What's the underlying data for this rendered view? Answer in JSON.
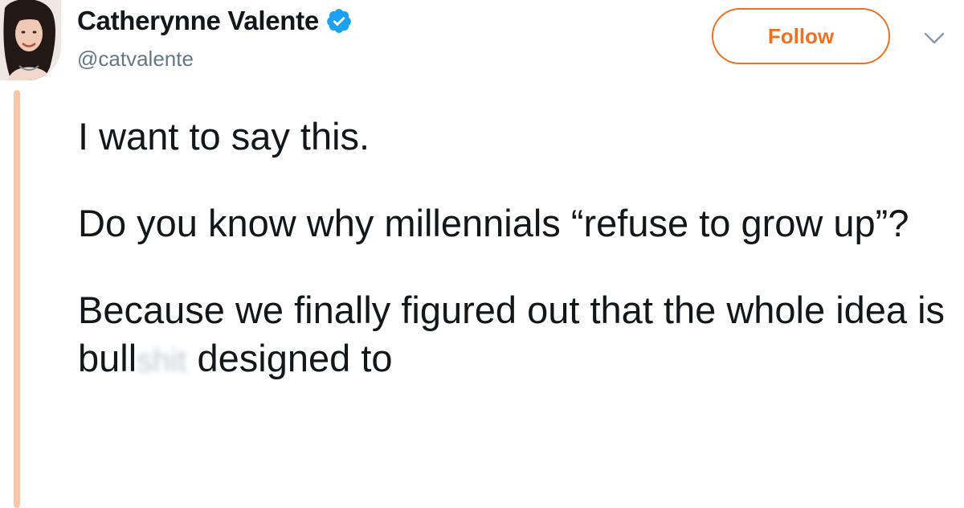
{
  "author": {
    "display_name": "Catherynne Valente",
    "handle": "@catvalente",
    "verified": true,
    "avatar_icon": "profile-photo"
  },
  "actions": {
    "follow_label": "Follow",
    "menu_icon": "chevron-down-icon"
  },
  "tweet": {
    "para1": "I want to say this.",
    "para2": "Do you know why millennials “refuse to grow up”?",
    "para3_before": "Because we finally figured out that the whole idea is bull",
    "para3_censored": "shit",
    "para3_after": " designed to"
  },
  "colors": {
    "accent": "#f37021",
    "verified": "#1da1f2",
    "thread_line": "#f6c8a9",
    "text": "#14171a",
    "secondary_text": "#657786"
  }
}
